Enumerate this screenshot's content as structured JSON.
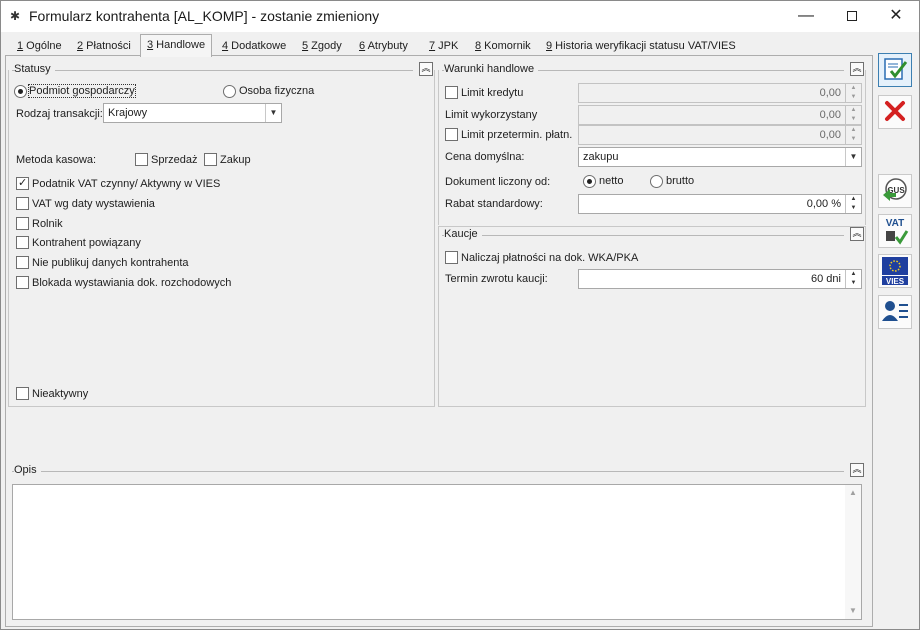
{
  "window": {
    "title": "Formularz kontrahenta [AL_KOMP] - zostanie zmieniony",
    "minimize": "—",
    "close": "✕"
  },
  "tabs": [
    {
      "num": "1",
      "label": " Ogólne"
    },
    {
      "num": "2",
      "label": " Płatności"
    },
    {
      "num": "3",
      "label": " Handlowe"
    },
    {
      "num": "4",
      "label": " Dodatkowe"
    },
    {
      "num": "5",
      "label": " Zgody"
    },
    {
      "num": "6",
      "label": " Atrybuty"
    },
    {
      "num": "7",
      "label": " JPK"
    },
    {
      "num": "8",
      "label": " Komornik"
    },
    {
      "num": "9",
      "label": " Historia weryfikacji statusu VAT/VIES"
    }
  ],
  "statusy": {
    "title": "Statusy",
    "podmiot_gospodarczy": "Podmiot gospodarczy",
    "osoba_fizyczna": "Osoba fizyczna",
    "rodzaj_transakcji_label": "Rodzaj transakcji:",
    "rodzaj_transakcji_value": "Krajowy",
    "metoda_kasowa_label": "Metoda kasowa:",
    "sprzedaz": "Sprzedaż",
    "zakup": "Zakup",
    "podatnik_vat": "Podatnik VAT czynny/ Aktywny w VIES",
    "vat_wg_daty": "VAT wg daty wystawienia",
    "rolnik": "Rolnik",
    "kontrahent_powiazany": "Kontrahent powiązany",
    "nie_publikuj": "Nie publikuj danych kontrahenta",
    "blokada": "Blokada wystawiania dok. rozchodowych",
    "nieaktywny": "Nieaktywny"
  },
  "warunki": {
    "title": "Warunki handlowe",
    "limit_kredytu_label": "Limit kredytu",
    "limit_kredytu_value": "0,00",
    "limit_wykorzystany_label": "Limit wykorzystany",
    "limit_wykorzystany_value": "0,00",
    "limit_przetermin_label": "Limit przetermin. płatn.",
    "limit_przetermin_value": "0,00",
    "cena_domyslna_label": "Cena domyślna:",
    "cena_domyslna_value": "zakupu",
    "dokument_liczony_label": "Dokument liczony od:",
    "netto": "netto",
    "brutto": "brutto",
    "rabat_label": "Rabat standardowy:",
    "rabat_value": "0,00 %"
  },
  "kaucje": {
    "title": "Kaucje",
    "naliczaj": "Naliczaj płatności na dok. WKA/PKA",
    "termin_label": "Termin zwrotu kaucji:",
    "termin_value": "60 dni"
  },
  "opis": {
    "title": "Opis"
  },
  "toolbar": {
    "gus_label": "GUS",
    "vat_label": "VAT",
    "vies_label": "VIES"
  }
}
